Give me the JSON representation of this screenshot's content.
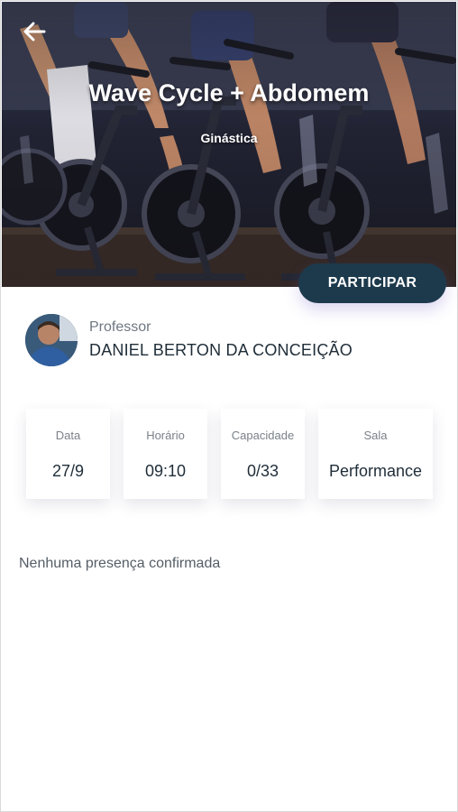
{
  "header": {
    "title": "Wave Cycle + Abdomem",
    "subtitle": "Ginástica"
  },
  "actions": {
    "participate_label": "PARTICIPAR"
  },
  "professor": {
    "label": "Professor",
    "name": "DANIEL BERTON DA CONCEIÇÃO"
  },
  "info_cards": [
    {
      "label": "Data",
      "value": "27/9"
    },
    {
      "label": "Horário",
      "value": "09:10"
    },
    {
      "label": "Capacidade",
      "value": "0/33"
    },
    {
      "label": "Sala",
      "value": "Performance"
    }
  ],
  "attendance": {
    "empty_message": "Nenhuma presença confirmada"
  },
  "colors": {
    "primary": "#1d3a4d",
    "text": "#1f2d38",
    "muted": "#7a8189"
  },
  "icons": {
    "back": "arrow-left-icon"
  }
}
